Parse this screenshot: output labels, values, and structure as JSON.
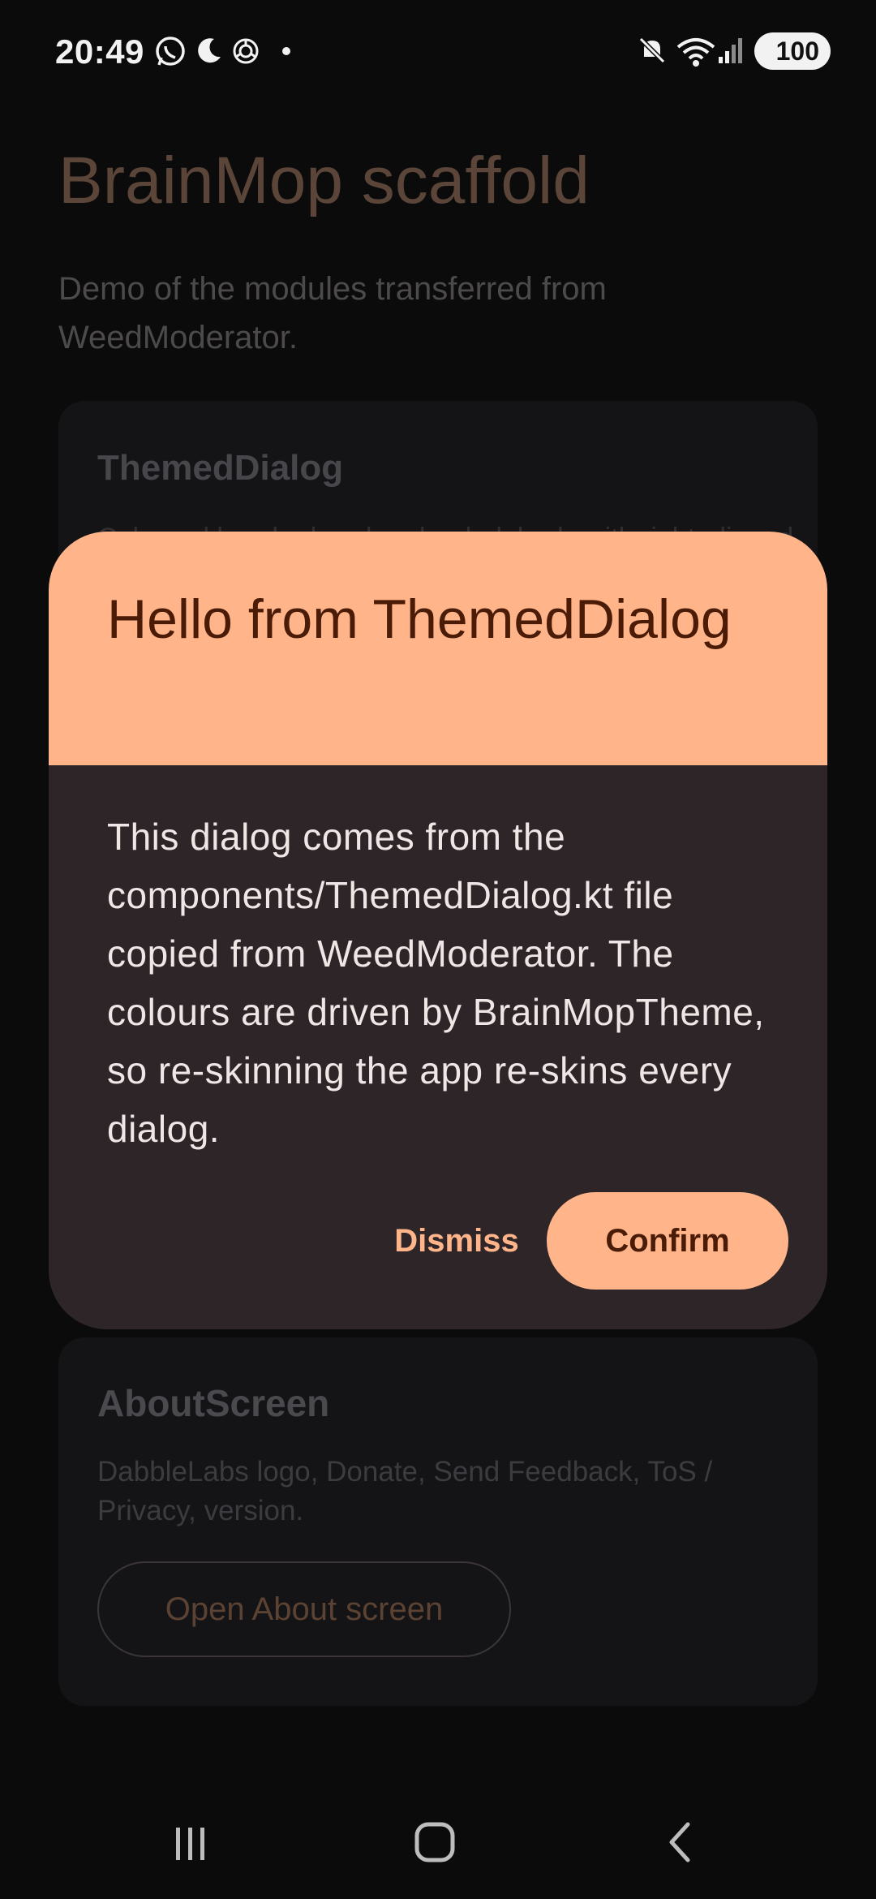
{
  "status_bar": {
    "time": "20:49",
    "battery": "100",
    "icons": [
      "whatsapp-icon",
      "moon-icon",
      "openai-icon",
      "dot-icon",
      "mute-icon",
      "wifi-icon",
      "signal-icon",
      "battery-icon"
    ]
  },
  "background": {
    "title": "BrainMop scaffold",
    "subtitle": "Demo of the modules transferred from WeedModerator.",
    "card1": {
      "title": "ThemedDialog",
      "text": "Coloured header band and a dark body with right-aligned"
    },
    "card2": {
      "title": "AboutScreen",
      "text": "DabbleLabs logo, Donate, Send Feedback, ToS / Privacy, version.",
      "button_label": "Open About screen"
    }
  },
  "dialog": {
    "title": "Hello from ThemedDialog",
    "body": "This dialog comes from the components/ThemedDialog.kt file copied from WeedModerator. The colours are driven by BrainMopTheme, so re-skinning the app re-skins every dialog.",
    "dismiss_label": "Dismiss",
    "confirm_label": "Confirm"
  },
  "colors": {
    "accent": "#ffb48a",
    "dialog_body": "#2e2528",
    "on_accent": "#4a1c08"
  },
  "nav_bar": {
    "icons": [
      "recents-icon",
      "home-icon",
      "back-icon"
    ]
  }
}
